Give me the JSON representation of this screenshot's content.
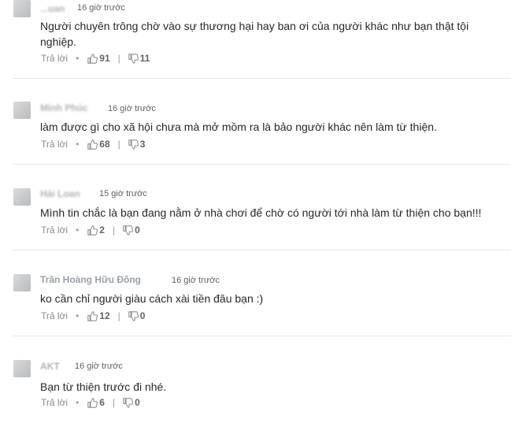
{
  "comments": [
    {
      "author": "...uan",
      "time": "16 giờ trước",
      "text": "Người chuyên trông chờ vào sự thương hại hay ban ơi của người khác như bạn thật tội nghiệp.",
      "reply": "Trả lời",
      "likes": "91",
      "dislikes": "11"
    },
    {
      "author": "Minh Phúc",
      "time": "16 giờ trước",
      "text": "làm được gì cho xã hội chưa mà mở mồm ra là bảo người khác nên làm từ thiện.",
      "reply": "Trả lời",
      "likes": "68",
      "dislikes": "3"
    },
    {
      "author": "Hải Loan",
      "time": "15 giờ trước",
      "text": "Mình tin chắc là bạn đang nằm ở nhà chơi để chờ có người tới nhà làm từ thiện cho bạn!!!",
      "reply": "Trả lời",
      "likes": "2",
      "dislikes": "0"
    },
    {
      "author": "Trần Hoàng Hữu Đông",
      "time": "16 giờ trước",
      "text": "ko cần chỉ người giàu cách xài tiền đâu bạn :)",
      "reply": "Trả lời",
      "likes": "12",
      "dislikes": "0"
    },
    {
      "author": "AKT",
      "time": "16 giờ trước",
      "text": "Bạn từ thiện trước đi nhé.",
      "reply": "Trả lời",
      "likes": "6",
      "dislikes": "0"
    }
  ],
  "icons": {
    "like": "thumbs-up-icon",
    "dislike": "thumbs-down-icon",
    "avatar": "avatar"
  },
  "colors": {
    "text": "#26282a",
    "meta": "#878b90",
    "divider": "#e6e8ea"
  }
}
